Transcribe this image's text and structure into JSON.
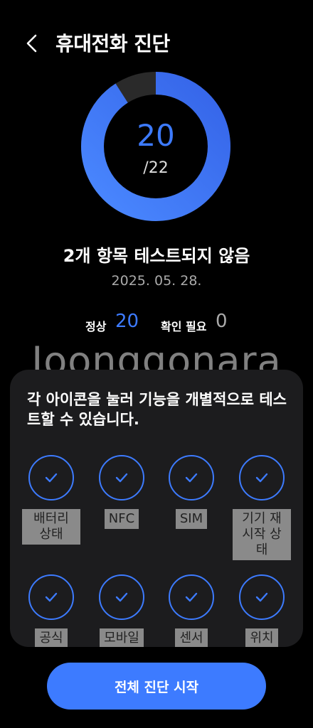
{
  "header": {
    "title": "휴대전화 진단",
    "back_icon": "back-arrow-icon"
  },
  "result": {
    "passed": "20",
    "total_text": "/22",
    "passed_fraction": 0.9091,
    "ring_color": "#3d7bff"
  },
  "summary": {
    "message": "2개 항목 테스트되지 않음",
    "date": "2025. 05. 28."
  },
  "stats": {
    "normal_label": "정상",
    "normal_value": "20",
    "check_label": "확인 필요",
    "check_value": "0"
  },
  "watermark": "Joonggonara",
  "panel": {
    "description": "각 아이콘을 눌러 기능을 개별적으로 테스트할 수 있습니다.",
    "items": [
      {
        "label": "배터리 상태"
      },
      {
        "label": "NFC"
      },
      {
        "label": "SIM"
      },
      {
        "label": "기기 재시작 상태"
      },
      {
        "label": "공식"
      },
      {
        "label": "모바일"
      },
      {
        "label": "센서"
      },
      {
        "label": "위치"
      }
    ]
  },
  "footer": {
    "start_label": "전체 진단 시작"
  }
}
